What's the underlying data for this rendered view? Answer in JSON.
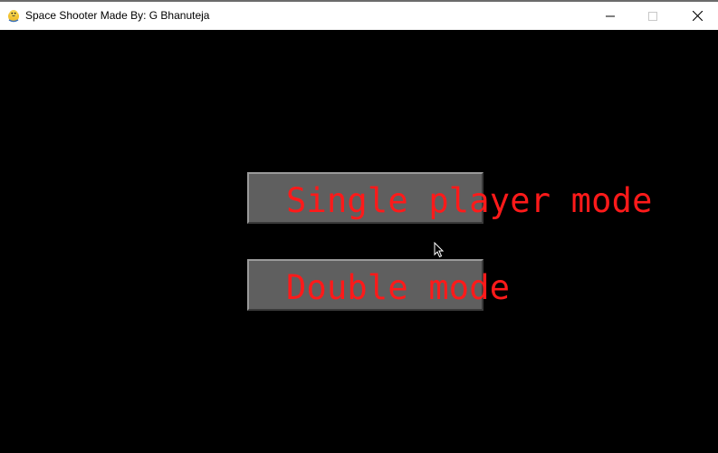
{
  "window": {
    "title": "Space Shooter Made By:  G Bhanuteja",
    "app_icon": "pygame-snake-icon",
    "controls": {
      "minimize_icon": "minimize-icon",
      "maximize_icon": "maximize-icon",
      "close_icon": "close-icon"
    }
  },
  "menu": {
    "single_player_label": "Single player mode",
    "double_mode_label": "Double mode"
  },
  "colors": {
    "background": "#000000",
    "button_fill": "#5f5f5f",
    "label_text": "#ff1a1a",
    "titlebar": "#ffffff"
  }
}
